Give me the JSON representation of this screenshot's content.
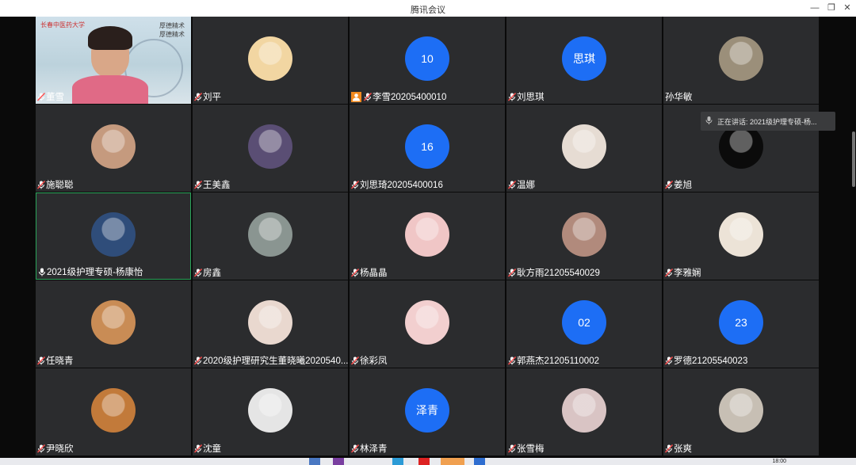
{
  "window": {
    "title": "腾讯会议"
  },
  "tiles": [
    {
      "name": "董雪",
      "kind": "video",
      "mic": "muted"
    },
    {
      "name": "刘平",
      "kind": "photo",
      "color": "#f2d6a2",
      "mic": "muted"
    },
    {
      "name": "李雪20205400010",
      "kind": "text",
      "avatar_text": "10",
      "mic": "muted",
      "host_icon": true
    },
    {
      "name": "刘思琪",
      "kind": "text",
      "avatar_text": "思琪",
      "mic": "muted"
    },
    {
      "name": "孙华敏",
      "kind": "photo",
      "color": "#9b8f7a",
      "mic": "none"
    },
    {
      "name": "施聪聪",
      "kind": "photo",
      "color": "#c59a7e",
      "mic": "muted"
    },
    {
      "name": "王美鑫",
      "kind": "photo",
      "color": "#5a4e74",
      "mic": "muted"
    },
    {
      "name": "刘思琦20205400016",
      "kind": "text",
      "avatar_text": "16",
      "mic": "muted"
    },
    {
      "name": "温娜",
      "kind": "photo",
      "color": "#e6dcd3",
      "mic": "muted"
    },
    {
      "name": "姜旭",
      "kind": "photo",
      "color": "#0b0b0b",
      "mic": "muted"
    },
    {
      "name": "2021级护理专硕-杨康怡",
      "kind": "photo",
      "color": "#2f4d7a",
      "mic": "active",
      "speaking": true
    },
    {
      "name": "房鑫",
      "kind": "photo",
      "color": "#8a9591",
      "mic": "muted"
    },
    {
      "name": "杨晶晶",
      "kind": "photo",
      "color": "#f0c6c6",
      "mic": "muted"
    },
    {
      "name": "耿方雨21205540029",
      "kind": "photo",
      "color": "#b18a7c",
      "mic": "muted"
    },
    {
      "name": "李雅娴",
      "kind": "photo",
      "color": "#ece3d7",
      "mic": "muted"
    },
    {
      "name": "任晓青",
      "kind": "photo",
      "color": "#c98c55",
      "mic": "muted"
    },
    {
      "name": "2020级护理研究生董晓曦2020540...",
      "kind": "photo",
      "color": "#e9d8cf",
      "mic": "muted"
    },
    {
      "name": "徐彩凤",
      "kind": "photo",
      "color": "#f2cfcf",
      "mic": "muted"
    },
    {
      "name": "郭燕杰21205110002",
      "kind": "text",
      "avatar_text": "02",
      "mic": "muted"
    },
    {
      "name": "罗德21205540023",
      "kind": "text",
      "avatar_text": "23",
      "mic": "muted"
    },
    {
      "name": "尹晓欣",
      "kind": "photo",
      "color": "#c27a3a",
      "mic": "muted"
    },
    {
      "name": "沈童",
      "kind": "photo",
      "color": "#e5e5e5",
      "mic": "muted"
    },
    {
      "name": "林泽青",
      "kind": "text",
      "avatar_text": "泽青",
      "mic": "muted"
    },
    {
      "name": "张雪梅",
      "kind": "photo",
      "color": "#d9c4c4",
      "mic": "muted"
    },
    {
      "name": "张爽",
      "kind": "photo",
      "color": "#c7bfb4",
      "mic": "muted"
    }
  ],
  "video_overlay": {
    "logo_text": "长春中医药大学",
    "motto_line1": "厚德精术",
    "motto_line2": "厚德精术"
  },
  "speaker_popup": {
    "label": "正在讲话: 2021级护理专硕-杨..."
  },
  "taskbar": {
    "clock": "18:00"
  },
  "colors": {
    "accent": "#1d6ef5",
    "tile_bg": "#2b2c2e",
    "speaking_border": "#2aa55a"
  }
}
